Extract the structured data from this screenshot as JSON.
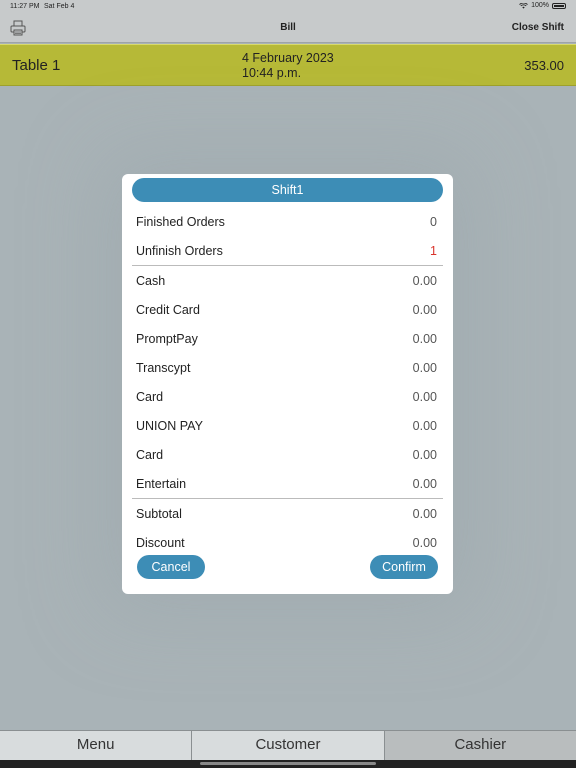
{
  "status_bar": {
    "time": "11:27 PM",
    "date": "Sat Feb 4",
    "battery": "100%"
  },
  "nav": {
    "title": "Bill",
    "close_shift": "Close Shift"
  },
  "bill": {
    "table": "Table 1",
    "date": "4 February 2023",
    "time": "10:44 p.m.",
    "amount": "353.00"
  },
  "modal": {
    "title": "Shift1",
    "rows": [
      {
        "label": "Finished Orders",
        "value": "0"
      },
      {
        "label": "Unfinish Orders",
        "value": "1"
      },
      {
        "label": "Cash",
        "value": "0.00"
      },
      {
        "label": "Credit Card",
        "value": "0.00"
      },
      {
        "label": "PromptPay",
        "value": "0.00"
      },
      {
        "label": "Transcypt",
        "value": "0.00"
      },
      {
        "label": "Card",
        "value": "0.00"
      },
      {
        "label": "UNION PAY",
        "value": "0.00"
      },
      {
        "label": "Card",
        "value": "0.00"
      },
      {
        "label": "Entertain",
        "value": "0.00"
      },
      {
        "label": "Subtotal",
        "value": "0.00"
      },
      {
        "label": "Discount",
        "value": "0.00"
      }
    ],
    "cancel": "Cancel",
    "confirm": "Confirm"
  },
  "tabs": [
    "Menu",
    "Customer",
    "Cashier"
  ],
  "colors": {
    "accent": "#3d8db6",
    "bill_row": "#b6b937",
    "alert": "#d9332b"
  }
}
